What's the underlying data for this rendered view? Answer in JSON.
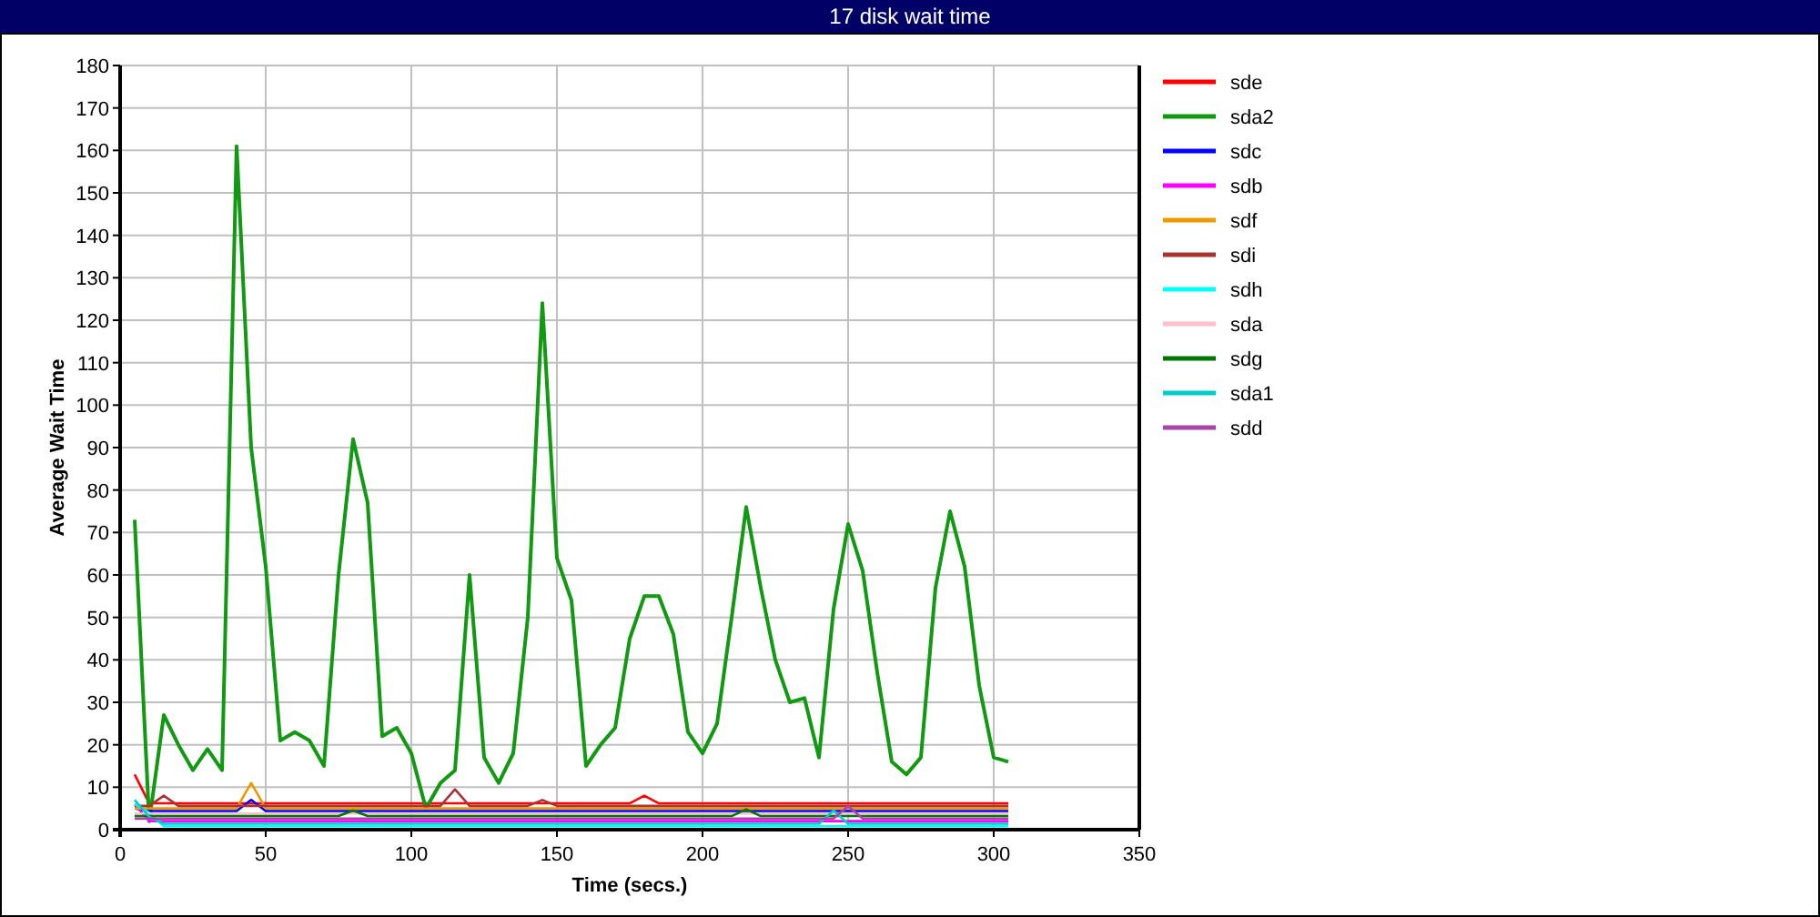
{
  "window": {
    "title": "17 disk wait time"
  },
  "chart": {
    "chart_data": {
      "type": "line",
      "xlabel": "Time (secs.)",
      "ylabel": "Average Wait Time",
      "xlim": [
        0,
        350
      ],
      "ylim": [
        0,
        180
      ],
      "grid": true,
      "legend": true,
      "xticks": [
        0,
        50,
        100,
        150,
        200,
        250,
        300,
        350
      ],
      "yticks": [
        0,
        10,
        20,
        30,
        40,
        50,
        60,
        70,
        80,
        90,
        100,
        110,
        120,
        130,
        140,
        150,
        160,
        170,
        180
      ],
      "x": [
        5,
        10,
        15,
        20,
        25,
        30,
        35,
        40,
        45,
        50,
        55,
        60,
        65,
        70,
        75,
        80,
        85,
        90,
        95,
        100,
        105,
        110,
        115,
        120,
        125,
        130,
        135,
        140,
        145,
        150,
        155,
        160,
        165,
        170,
        175,
        180,
        185,
        190,
        195,
        200,
        205,
        210,
        215,
        220,
        225,
        230,
        235,
        240,
        245,
        250,
        255,
        260,
        265,
        270,
        275,
        280,
        285,
        290,
        295,
        300,
        305
      ],
      "series": [
        {
          "name": "sde",
          "color": "#ff0000",
          "values": [
            13,
            6.2,
            6.2,
            6.2,
            6.2,
            6.2,
            6.2,
            6.2,
            6.2,
            6.2,
            6.2,
            6.2,
            6.2,
            6.2,
            6.2,
            6.2,
            6.2,
            6.2,
            6.2,
            6.2,
            6.2,
            6.2,
            6.2,
            6.2,
            6.2,
            6.2,
            6.2,
            6.2,
            6.2,
            6.2,
            6.2,
            6.2,
            6.2,
            6.2,
            6.2,
            8,
            6.2,
            6.2,
            6.2,
            6.2,
            6.2,
            6.2,
            6.2,
            6.2,
            6.2,
            6.2,
            6.2,
            6.2,
            6.2,
            6.2,
            6.2,
            6.2,
            6.2,
            6.2,
            6.2,
            6.2,
            6.2,
            6.2,
            6.2,
            6.2,
            6.2
          ]
        },
        {
          "name": "sda2",
          "color": "#119911",
          "values": [
            73,
            2,
            27,
            20,
            14,
            19,
            14,
            161,
            90,
            62,
            21,
            23,
            21,
            15,
            60,
            92,
            77,
            22,
            24,
            18,
            5,
            11,
            14,
            60,
            17,
            11,
            18,
            50,
            124,
            64,
            54,
            15,
            20,
            24,
            45,
            55,
            55,
            46,
            23,
            18,
            25,
            50,
            76,
            57,
            40,
            30,
            31,
            17,
            52,
            72,
            61,
            37,
            16,
            13,
            17,
            57,
            75,
            62,
            34,
            17,
            16
          ]
        },
        {
          "name": "sdc",
          "color": "#0000ff",
          "values": [
            5,
            4.4,
            4.4,
            4.4,
            4.4,
            4.4,
            4.4,
            4.4,
            7,
            4.4,
            4.4,
            4.4,
            4.4,
            4.4,
            4.4,
            4.4,
            4.4,
            4.4,
            4.4,
            4.4,
            4.4,
            4.4,
            4.4,
            4.4,
            4.4,
            4.4,
            4.4,
            4.4,
            4.4,
            4.4,
            4.4,
            4.4,
            4.4,
            4.4,
            4.4,
            4.4,
            4.4,
            4.4,
            4.4,
            4.4,
            4.4,
            4.4,
            4.4,
            4.4,
            4.4,
            4.4,
            4.4,
            4.4,
            4.4,
            4.4,
            4.4,
            4.4,
            4.4,
            4.4,
            4.4,
            4.4,
            4.4,
            4.4,
            4.4,
            4.4,
            4.4
          ]
        },
        {
          "name": "sdb",
          "color": "#ff00ff",
          "values": [
            6,
            2,
            2,
            2,
            2,
            2,
            2,
            2,
            2,
            2,
            2,
            2,
            2,
            2,
            2,
            2,
            2,
            2,
            2,
            2,
            2,
            2,
            2,
            2,
            2,
            2,
            2,
            2,
            2,
            2,
            2,
            2,
            2,
            2,
            2,
            2,
            2,
            2,
            2,
            2,
            2,
            2,
            2,
            2,
            2,
            2,
            2,
            2,
            2,
            2,
            2,
            2,
            2,
            2,
            2,
            2,
            2,
            2,
            2,
            2,
            2
          ]
        },
        {
          "name": "sdf",
          "color": "#ee9900",
          "values": [
            5,
            5,
            5,
            5,
            5,
            5,
            5,
            5,
            11,
            5,
            5,
            5,
            5,
            5,
            5,
            5,
            5,
            5,
            5,
            5,
            5,
            5,
            5,
            5,
            5,
            5,
            5,
            5,
            5,
            5,
            5,
            5,
            5,
            5,
            5,
            5,
            5,
            5,
            5,
            5,
            5,
            5,
            5,
            5,
            5,
            5,
            5,
            5,
            5,
            5,
            5,
            5,
            5,
            5,
            5,
            5,
            5,
            5,
            5,
            5,
            5
          ]
        },
        {
          "name": "sdi",
          "color": "#aa3333",
          "values": [
            5.6,
            5.6,
            8,
            5.6,
            5.6,
            5.6,
            5.6,
            5.6,
            5.6,
            5.6,
            5.6,
            5.6,
            5.6,
            5.6,
            5.6,
            5.6,
            5.6,
            5.6,
            5.6,
            5.6,
            5.6,
            5.6,
            9.5,
            5.6,
            5.6,
            5.6,
            5.6,
            5.6,
            7,
            5.6,
            5.6,
            5.6,
            5.6,
            5.6,
            5.6,
            5.6,
            5.6,
            5.6,
            5.6,
            5.6,
            5.6,
            5.6,
            5.6,
            5.6,
            5.6,
            5.6,
            5.6,
            5.6,
            5.6,
            5.6,
            5.6,
            5.6,
            5.6,
            5.6,
            5.6,
            5.6,
            5.6,
            5.6,
            5.6,
            5.6,
            5.6
          ]
        },
        {
          "name": "sdh",
          "color": "#00ffff",
          "values": [
            6,
            4,
            0.8,
            0.8,
            0.8,
            0.8,
            0.8,
            0.8,
            0.8,
            0.8,
            0.8,
            0.8,
            0.8,
            0.8,
            0.8,
            0.8,
            0.8,
            0.8,
            0.8,
            0.8,
            0.8,
            0.8,
            0.8,
            0.8,
            0.8,
            0.8,
            0.8,
            0.8,
            0.8,
            0.8,
            0.8,
            0.8,
            0.8,
            0.8,
            0.8,
            0.8,
            0.8,
            0.8,
            0.8,
            0.8,
            0.8,
            0.8,
            0.8,
            0.8,
            0.8,
            0.8,
            0.8,
            0.8,
            0.8,
            0.8,
            0.8,
            0.8,
            0.8,
            0.8,
            0.8,
            0.8,
            0.8,
            0.8,
            0.8,
            0.8,
            0.8
          ]
        },
        {
          "name": "sda",
          "color": "#ffc0cb",
          "values": [
            3.8,
            3.8,
            3.8,
            3.8,
            3.8,
            3.8,
            3.8,
            3.8,
            3.8,
            3.8,
            3.8,
            3.8,
            3.8,
            3.8,
            3.8,
            3.8,
            3.8,
            3.8,
            3.8,
            3.8,
            3.8,
            3.8,
            3.8,
            3.8,
            3.8,
            3.8,
            3.8,
            3.8,
            3.8,
            3.8,
            3.8,
            3.8,
            3.8,
            3.8,
            3.8,
            3.8,
            3.8,
            3.8,
            3.8,
            3.8,
            3.8,
            3.8,
            3.8,
            3.8,
            3.8,
            3.8,
            3.8,
            3.8,
            3.8,
            3.8,
            3.8,
            3.8,
            3.8,
            3.8,
            3.8,
            3.8,
            3.8,
            3.8,
            3.8,
            3.8,
            3.8
          ]
        },
        {
          "name": "sdg",
          "color": "#007700",
          "values": [
            3.2,
            3.2,
            3.2,
            3.2,
            3.2,
            3.2,
            3.2,
            3.2,
            3.2,
            3.2,
            3.2,
            3.2,
            3.2,
            3.2,
            3.2,
            4.5,
            3.2,
            3.2,
            3.2,
            3.2,
            3.2,
            3.2,
            3.2,
            3.2,
            3.2,
            3.2,
            3.2,
            3.2,
            3.2,
            3.2,
            3.2,
            3.2,
            3.2,
            3.2,
            3.2,
            3.2,
            3.2,
            3.2,
            3.2,
            3.2,
            3.2,
            3.2,
            4.8,
            3.2,
            3.2,
            3.2,
            3.2,
            3.2,
            3.2,
            3.2,
            3.2,
            3.2,
            3.2,
            3.2,
            3.2,
            3.2,
            3.2,
            3.2,
            3.2,
            3.2,
            3.2
          ]
        },
        {
          "name": "sda1",
          "color": "#00cccc",
          "values": [
            7,
            3,
            1.4,
            1.4,
            1.4,
            1.4,
            1.4,
            1.4,
            1.4,
            1.4,
            1.4,
            1.4,
            1.4,
            1.4,
            1.4,
            1.4,
            1.4,
            1.4,
            1.4,
            1.4,
            1.4,
            1.4,
            1.4,
            1.4,
            1.4,
            1.4,
            1.4,
            1.4,
            1.4,
            1.4,
            1.4,
            1.4,
            1.4,
            1.4,
            1.4,
            1.4,
            1.4,
            1.4,
            1.4,
            1.4,
            1.4,
            1.4,
            1.4,
            1.4,
            1.4,
            1.4,
            1.4,
            1.4,
            4.5,
            1.4,
            1.4,
            1.4,
            1.4,
            1.4,
            1.4,
            1.4,
            1.4,
            1.4,
            1.4,
            1.4,
            1.4
          ]
        },
        {
          "name": "sdd",
          "color": "#aa44aa",
          "values": [
            2.6,
            2.6,
            2.6,
            2.6,
            2.6,
            2.6,
            2.6,
            2.6,
            2.6,
            2.6,
            2.6,
            2.6,
            2.6,
            2.6,
            2.6,
            2.6,
            2.6,
            2.6,
            2.6,
            2.6,
            2.6,
            2.6,
            2.6,
            2.6,
            2.6,
            2.6,
            2.6,
            2.6,
            2.6,
            2.6,
            2.6,
            2.6,
            2.6,
            2.6,
            2.6,
            2.6,
            2.6,
            2.6,
            2.6,
            2.6,
            2.6,
            2.6,
            2.6,
            2.6,
            2.6,
            2.6,
            2.6,
            2.6,
            2.6,
            5.5,
            2.6,
            2.6,
            2.6,
            2.6,
            2.6,
            2.6,
            2.6,
            2.6,
            2.6,
            2.6,
            2.6
          ]
        }
      ]
    }
  }
}
